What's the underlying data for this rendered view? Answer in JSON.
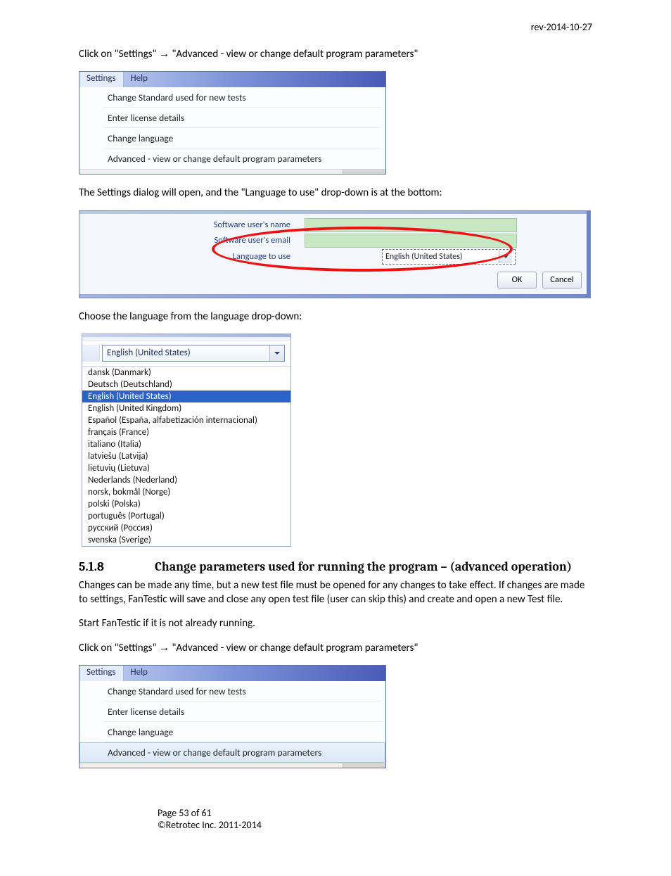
{
  "header": {
    "revision": "rev-2014-10-27"
  },
  "text": {
    "intro1_a": "Click on \"Settings\" ",
    "intro1_b": " \"Advanced - view or change default program parameters\"",
    "intro2": "The Settings dialog will open, and the \"Language to use\" drop-down is at the bottom:",
    "intro3": "Choose the language from the language drop-down:",
    "para1": "Changes can be made any time, but a new test file must be opened for any changes to take effect.  If changes are made to settings, FanTestic will save and close any open test file (user can skip this) and create and open a new Test file.",
    "para2": "Start FanTestic if it is not already running.",
    "para3_a": "Click on \"Settings\" ",
    "para3_b": " \"Advanced - view or change default program parameters\""
  },
  "arrow_glyph": "→",
  "menu": {
    "bar": [
      "Settings",
      "Help"
    ],
    "items": [
      "Change Standard used for new tests",
      "Enter license details",
      "Change language",
      "Advanced - view or change default program parameters"
    ],
    "hover_index_top": -1,
    "hover_index_bottom": 3
  },
  "dialog": {
    "rows": [
      {
        "label": "Software user's name",
        "type": "field"
      },
      {
        "label": "Software user's email",
        "type": "field"
      },
      {
        "label": "Language to use",
        "type": "select",
        "value": "English (United States)"
      }
    ],
    "buttons": {
      "ok": "OK",
      "cancel": "Cancel"
    }
  },
  "languages": {
    "selected": "English (United States)",
    "options": [
      "dansk (Danmark)",
      "Deutsch (Deutschland)",
      "English (United States)",
      "English (United Kingdom)",
      "Español (España, alfabetización internacional)",
      "français (France)",
      "italiano (Italia)",
      "latviešu (Latvija)",
      "lietuvių (Lietuva)",
      "Nederlands (Nederland)",
      "norsk, bokmål (Norge)",
      "polski (Polska)",
      "português (Portugal)",
      "русский (Россия)",
      "svenska (Sverige)"
    ],
    "highlight_index": 2
  },
  "section": {
    "number": "5.1.8",
    "title": "Change parameters used for running the program – (advanced operation)"
  },
  "footer": {
    "page": "Page 53 of 61",
    "copyright": "©Retrotec Inc. 2011-2014"
  }
}
